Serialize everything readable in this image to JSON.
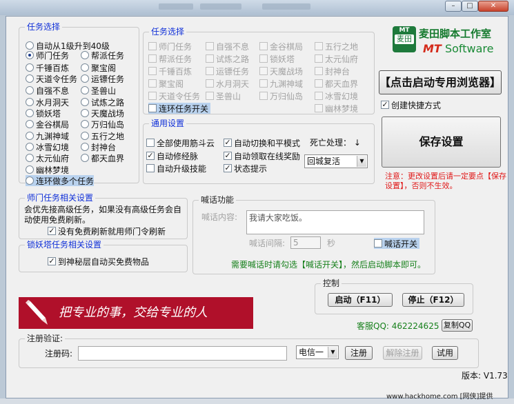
{
  "window": {
    "min": "–",
    "max": "□",
    "close": "✕"
  },
  "taskSelect": {
    "title": "任务选择",
    "items": [
      {
        "label": "自动从1级升到40级",
        "on": false
      },
      {
        "label": "师门任务",
        "on": true
      },
      {
        "label": "帮派任务",
        "on": false
      },
      {
        "label": "千锤百炼",
        "on": false
      },
      {
        "label": "聚宝阁",
        "on": false
      },
      {
        "label": "天道令任务",
        "on": false
      },
      {
        "label": "运镖任务",
        "on": false
      },
      {
        "label": "自强不息",
        "on": false
      },
      {
        "label": "圣兽山",
        "on": false
      },
      {
        "label": "水月洞天",
        "on": false
      },
      {
        "label": "试炼之路",
        "on": false
      },
      {
        "label": "锁妖塔",
        "on": false
      },
      {
        "label": "天魔战场",
        "on": false
      },
      {
        "label": "金谷棋局",
        "on": false
      },
      {
        "label": "万归仙岛",
        "on": false
      },
      {
        "label": "九渊神域",
        "on": false
      },
      {
        "label": "五行之地",
        "on": false
      },
      {
        "label": "冰雪幻境",
        "on": false
      },
      {
        "label": "封神台",
        "on": false
      },
      {
        "label": "太元仙府",
        "on": false
      },
      {
        "label": "都天血界",
        "on": false
      },
      {
        "label": "幽林梦境",
        "on": false
      },
      {
        "label": "连环做多个任务",
        "on": false
      }
    ]
  },
  "taskSelect2": {
    "title": "任务选择",
    "items": [
      "师门任务",
      "自强不息",
      "金谷棋局",
      "五行之地",
      "帮派任务",
      "试炼之路",
      "锁妖塔",
      "太元仙府",
      "千锤百炼",
      "运镖任务",
      "天魔战场",
      "封神台",
      "聚宝阁",
      "水月洞天",
      "九渊神域",
      "都天血界",
      "天道令任务",
      "圣兽山",
      "万归仙岛",
      "冰雪幻境",
      "连环任务开关",
      "幽林梦境"
    ]
  },
  "logo": {
    "badge_top": "MT",
    "badge_mid": "麦田",
    "name": "麦田脚本工作室",
    "brand": "MT",
    "brand_rest": "Software"
  },
  "launchBrowser": "【点击启动专用浏览器】",
  "createShortcut": "创建快捷方式",
  "saveSettings": "保存设置",
  "note": "注意：更改设置后请一定要点【保存设置】，否则不生效。",
  "general": {
    "title": "通用设置",
    "fullJindou": "全部使用筋斗云",
    "autoSwitch": "自动切换和平模式",
    "deathLabel": "死亡处理：",
    "autoCultivate": "自动修经脉",
    "autoOnlineReward": "自动领取在线奖励",
    "deathOption": "回城复活",
    "autoUpgradeSkill": "自动升级技能",
    "statusHint": "状态提示"
  },
  "shout": {
    "title": "喊话功能",
    "contentLabel": "喊话内容:",
    "content": "我请大家吃饭。",
    "intervalLabel": "喊话间隔:",
    "interval": "5",
    "unit": "秒",
    "toggle": "喊话开关",
    "hint": "需要喊话时请勾选【喊话开关】，然后启动脚本即可。"
  },
  "shimen": {
    "title": "师门任务相关设置",
    "desc": "会优先接高级任务，如果没有高级任务会自动使用免费刷新。",
    "option": "没有免费刷新就用师门令刷新"
  },
  "suoyao": {
    "title": "锁妖塔任务相关设置",
    "option": "到神秘层自动买免费物品"
  },
  "banner": "把专业的事，交给专业的人",
  "control": {
    "title": "控制",
    "start": "启动（F11）",
    "stop": "停止（F12）"
  },
  "service": {
    "label": "客服QQ:  462224625",
    "copy": "复制QQ"
  },
  "register": {
    "title": "注册验证:",
    "codeLabel": "注册码:",
    "code": "",
    "isp": "电信一",
    "registerBtn": "注册",
    "unregisterBtn": "解除注册",
    "trialBtn": "试用"
  },
  "version": "版本:  V1.73",
  "watermark": "www.hackhome.com [网侠]提供"
}
